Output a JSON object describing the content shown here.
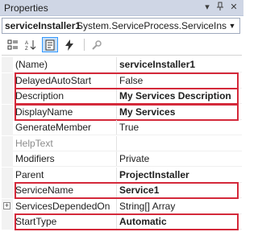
{
  "window": {
    "title": "Properties",
    "pin_icon": "pin-icon",
    "close_icon": "close-icon"
  },
  "object_selector": {
    "name": "serviceInstaller1",
    "type": "System.ServiceProcess.ServiceInst"
  },
  "toolbar": {
    "buttons": [
      {
        "icon": "categorized-icon",
        "active": false
      },
      {
        "icon": "alphabetical-icon",
        "active": false
      },
      {
        "icon": "properties-icon",
        "active": true
      },
      {
        "icon": "events-icon",
        "active": false
      },
      {
        "icon": "property-pages-icon",
        "active": false,
        "disabled": true
      }
    ]
  },
  "properties": [
    {
      "name": "(Name)",
      "value": "serviceInstaller1",
      "bold": true,
      "highlighted": false
    },
    {
      "name": "DelayedAutoStart",
      "value": "False",
      "bold": false,
      "highlighted": true
    },
    {
      "name": "Description",
      "value": "My Services Description",
      "bold": true,
      "highlighted": true
    },
    {
      "name": "DisplayName",
      "value": "My Services",
      "bold": true,
      "highlighted": true
    },
    {
      "name": "GenerateMember",
      "value": "True",
      "bold": false,
      "highlighted": false
    },
    {
      "name": "HelpText",
      "value": "",
      "bold": false,
      "highlighted": false,
      "muted": true
    },
    {
      "name": "Modifiers",
      "value": "Private",
      "bold": false,
      "highlighted": false
    },
    {
      "name": "Parent",
      "value": "ProjectInstaller",
      "bold": true,
      "highlighted": false
    },
    {
      "name": "ServiceName",
      "value": "Service1",
      "bold": true,
      "highlighted": true
    },
    {
      "name": "ServicesDependedOn",
      "value": "String[] Array",
      "bold": false,
      "highlighted": false,
      "expandable": true
    },
    {
      "name": "StartType",
      "value": "Automatic",
      "bold": true,
      "highlighted": true
    }
  ],
  "colors": {
    "highlight_border": "#d4293a",
    "titlebar_bg": "#cfd6e5",
    "active_button_border": "#3399ff"
  }
}
